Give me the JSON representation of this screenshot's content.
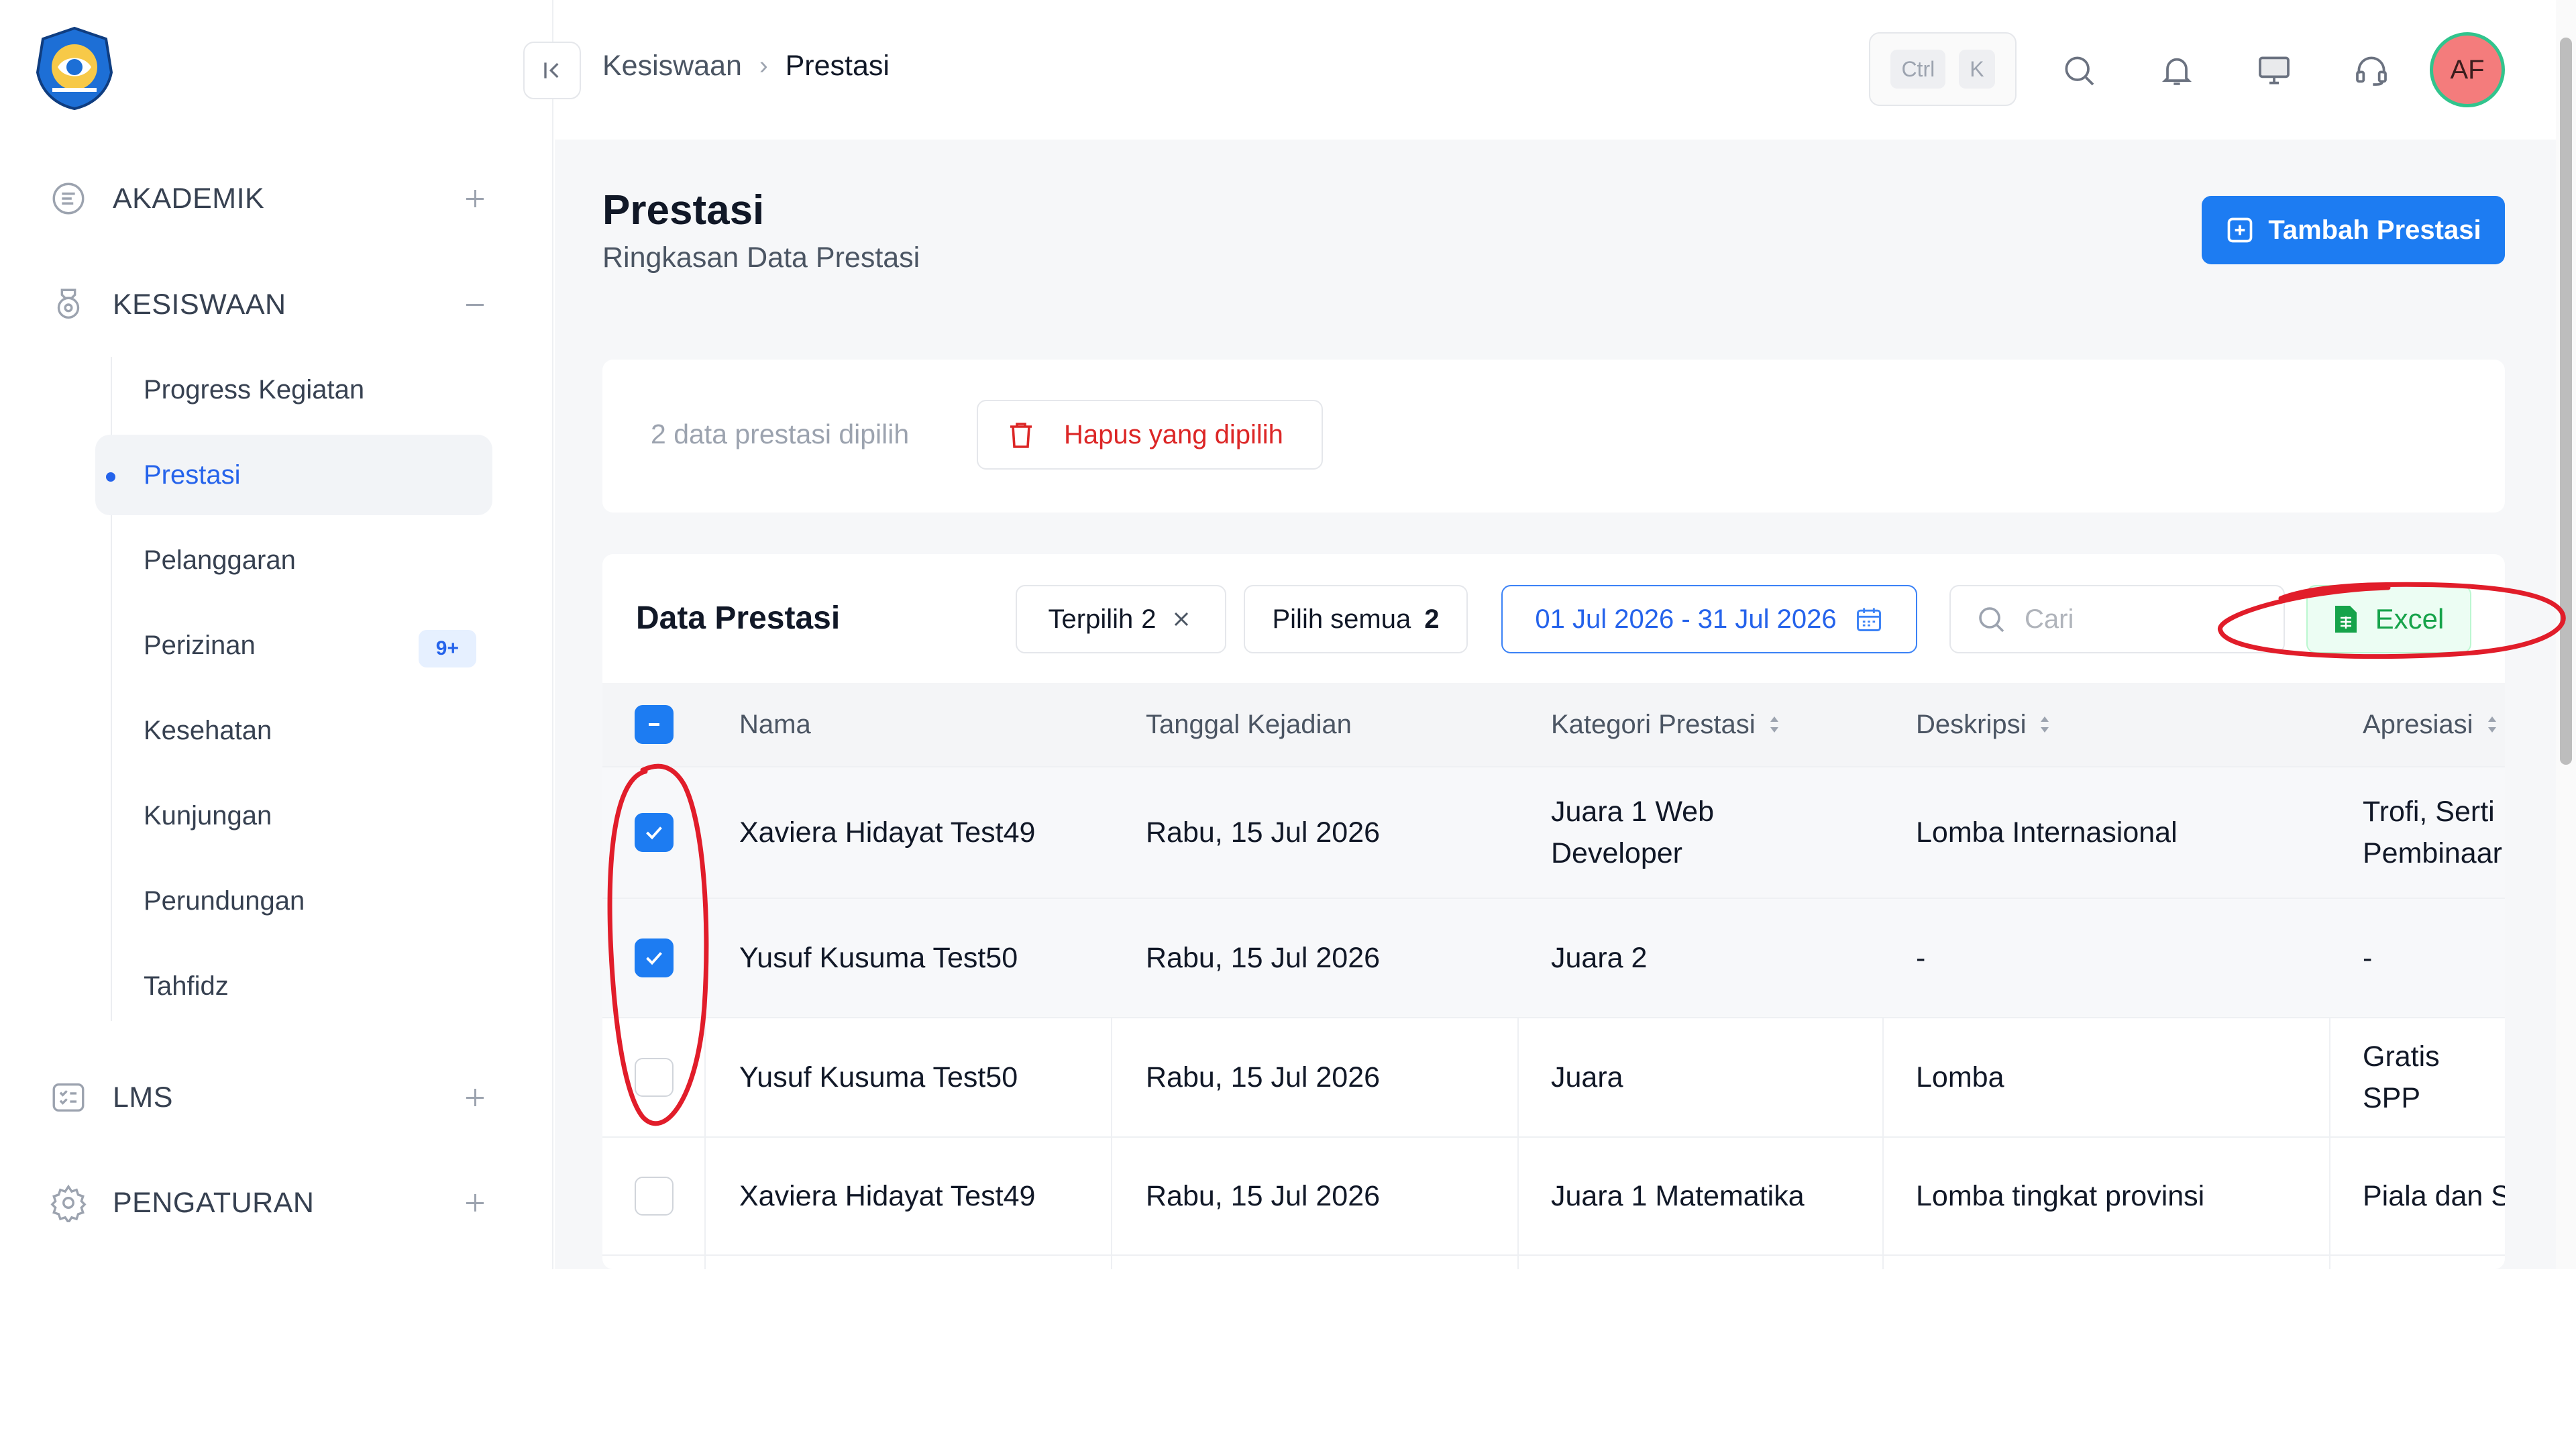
{
  "sidebar": {
    "groups": [
      {
        "label": "AKADEMIK",
        "icon": "book-icon",
        "state": "collapsed"
      },
      {
        "label": "KESISWAAN",
        "icon": "student-icon",
        "state": "expanded"
      },
      {
        "label": "LMS",
        "icon": "checklist-icon",
        "state": "collapsed"
      },
      {
        "label": "PENGATURAN",
        "icon": "gear-icon",
        "state": "collapsed"
      }
    ],
    "kesiswaan_items": [
      {
        "label": "Progress Kegiatan"
      },
      {
        "label": "Prestasi",
        "active": true
      },
      {
        "label": "Pelanggaran"
      },
      {
        "label": "Perizinan",
        "badge": "9+"
      },
      {
        "label": "Kesehatan"
      },
      {
        "label": "Kunjungan"
      },
      {
        "label": "Perundungan"
      },
      {
        "label": "Tahfidz"
      }
    ]
  },
  "topbar": {
    "breadcrumb": [
      "Kesiswaan",
      "Prestasi"
    ],
    "shortcut": [
      "Ctrl",
      "K"
    ],
    "avatar": "AF",
    "icons": [
      "search-icon",
      "bell-icon",
      "monitor-icon",
      "headset-icon"
    ]
  },
  "page": {
    "title": "Prestasi",
    "subtitle": "Ringkasan Data Prestasi",
    "add_button": "Tambah Prestasi"
  },
  "selection": {
    "count_text": "2 data prestasi dipilih",
    "delete_label": "Hapus yang dipilih"
  },
  "table_card": {
    "title": "Data Prestasi",
    "selected_chip": {
      "label": "Terpilih",
      "count": "2"
    },
    "select_all_chip": {
      "label": "Pilih semua",
      "count": "2"
    },
    "date_range": "01 Jul 2026 - 31 Jul 2026",
    "search_placeholder": "Cari",
    "excel_label": "Excel",
    "columns": [
      "Nama",
      "Tanggal Kejadian",
      "Kategori Prestasi",
      "Deskripsi",
      "Apresiasi"
    ],
    "rows": [
      {
        "checked": true,
        "nama": "Xaviera Hidayat Test49",
        "tanggal": "Rabu, 15 Jul 2026",
        "kategori": "Juara 1 Web Developer",
        "deskripsi": "Lomba Internasional",
        "apresiasi": "Trofi, Serti Pembinaar"
      },
      {
        "checked": true,
        "nama": "Yusuf Kusuma Test50",
        "tanggal": "Rabu, 15 Jul 2026",
        "kategori": "Juara 2",
        "deskripsi": "-",
        "apresiasi": "-"
      },
      {
        "checked": false,
        "nama": "Yusuf Kusuma Test50",
        "tanggal": "Rabu, 15 Jul 2026",
        "kategori": "Juara",
        "deskripsi": "Lomba",
        "apresiasi": "Gratis SPP"
      },
      {
        "checked": false,
        "nama": "Xaviera Hidayat Test49",
        "tanggal": "Rabu, 15 Jul 2026",
        "kategori": "Juara 1 Matematika",
        "deskripsi": "Lomba tingkat provinsi",
        "apresiasi": "Piala dan S"
      }
    ]
  },
  "colors": {
    "primary": "#1d7cf2",
    "danger": "#dc2626",
    "success": "#16a34a",
    "annotation": "#e11d2a"
  }
}
